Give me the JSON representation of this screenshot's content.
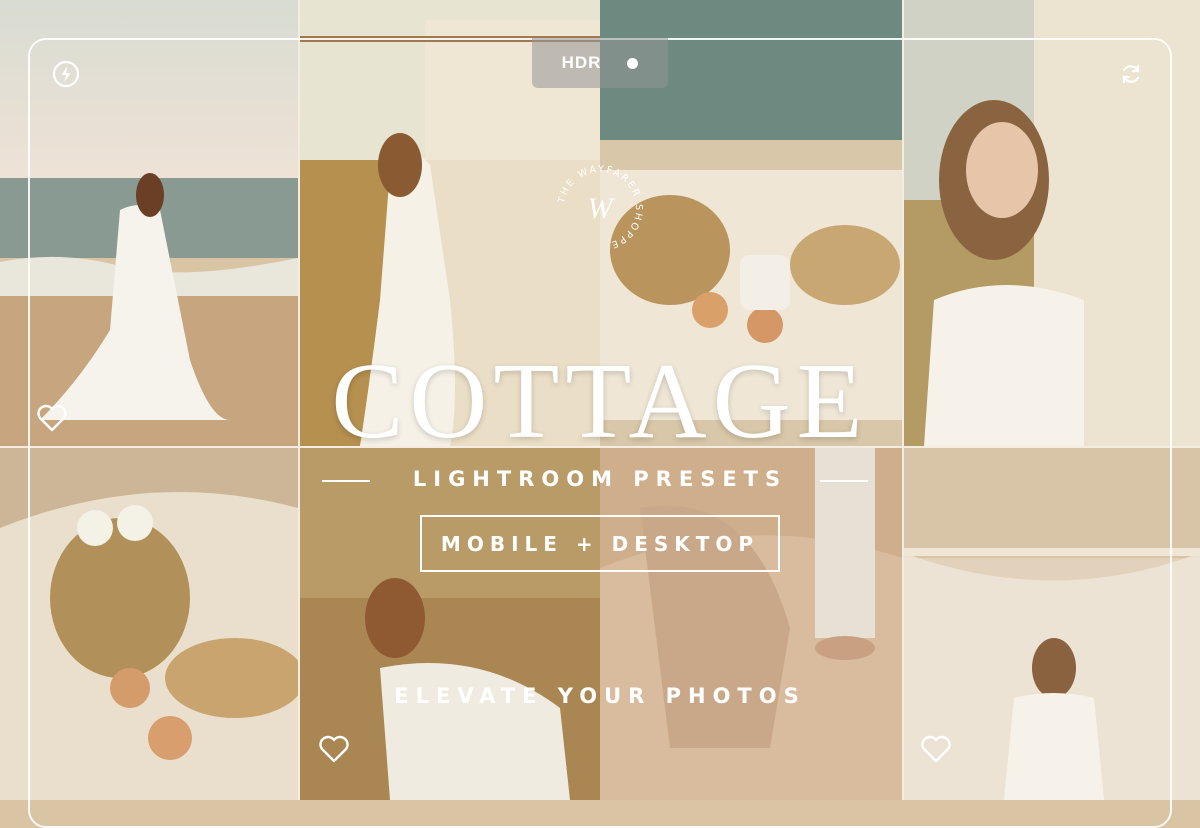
{
  "header": {
    "hdr_label": "HDR"
  },
  "hero": {
    "title": "COTTAGE",
    "subtitle": "LIGHTROOM PRESETS",
    "platform_badge": "MOBILE + DESKTOP",
    "tagline": "ELEVATE YOUR PHOTOS"
  },
  "brand": {
    "logo_text": "THE WAYFARER SHOPPE",
    "monogram": "W"
  },
  "icons": {
    "top_left": "flash-icon",
    "top_right": "refresh-icon",
    "likes": [
      "heart-icon",
      "heart-icon",
      "heart-icon"
    ]
  },
  "colors": {
    "frame": "#ffffff",
    "sand": "#d9c4a3",
    "cream": "#f1e8d7",
    "sea": "#6f8f88",
    "grass": "#b8955d"
  }
}
